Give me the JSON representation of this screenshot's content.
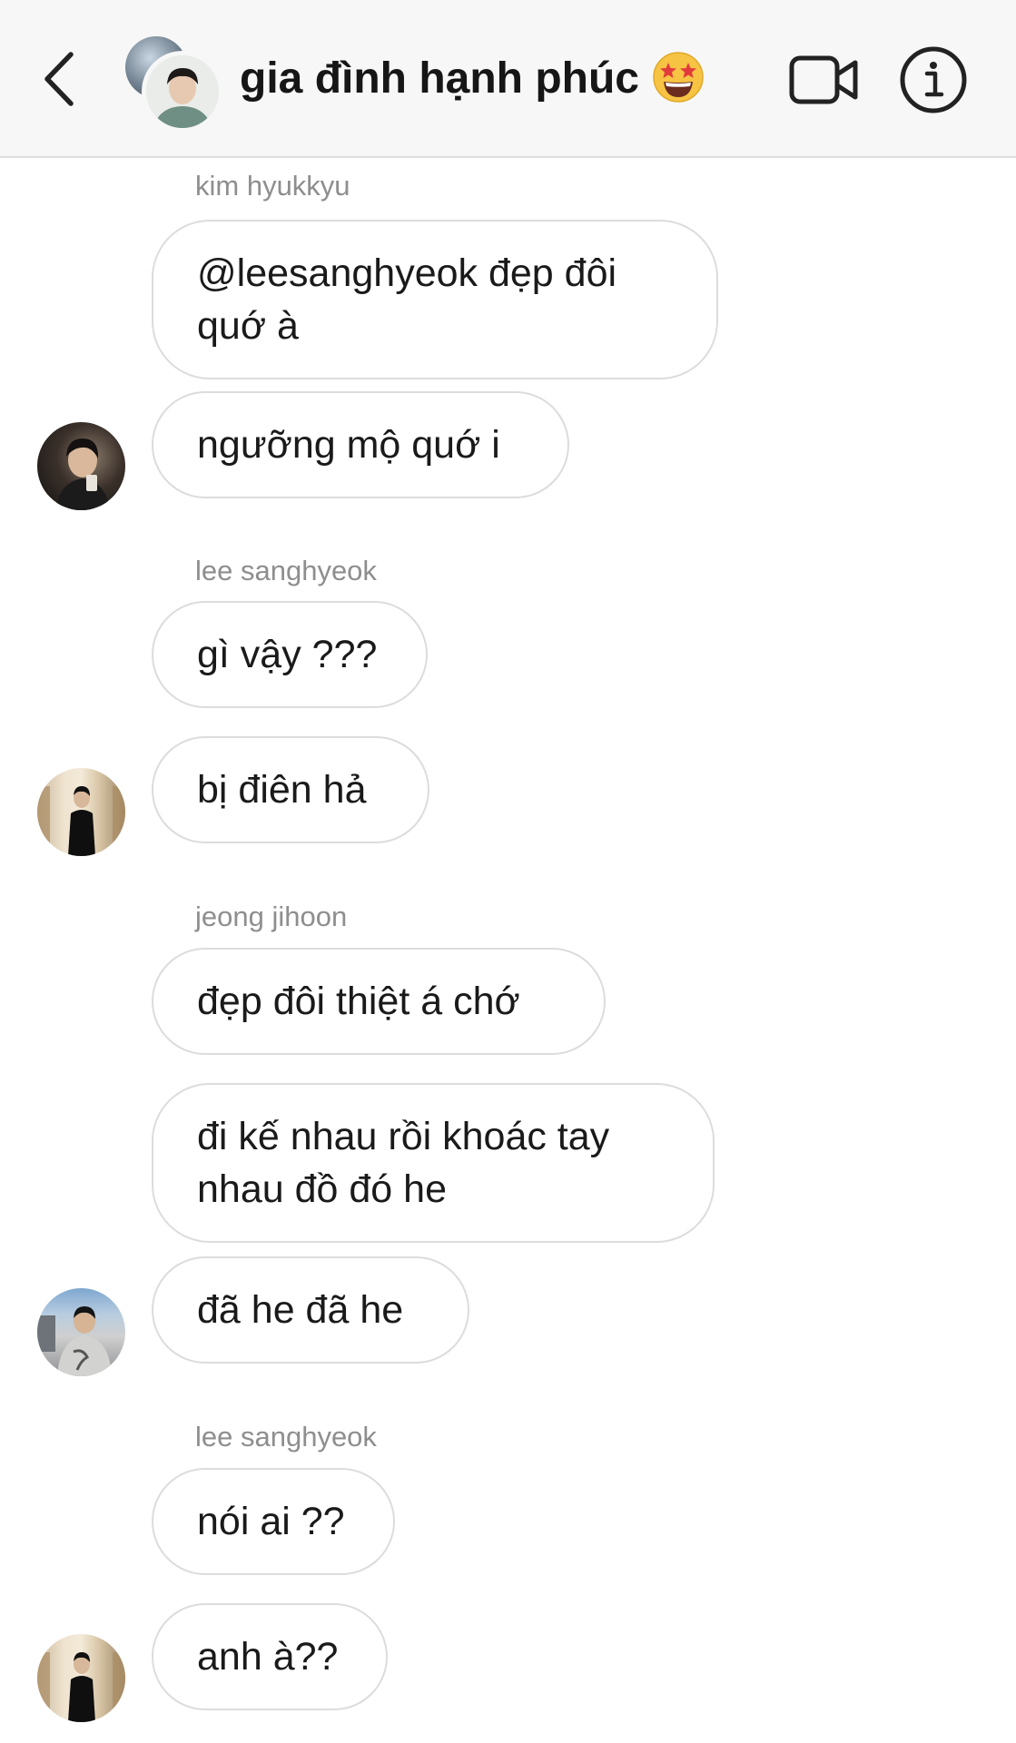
{
  "header": {
    "title": "gia đình hạnh phúc",
    "emoji_name": "star-struck-emoji",
    "back_icon": "chevron-left-icon",
    "video_icon": "video-camera-icon",
    "info_icon": "info-icon"
  },
  "colors": {
    "header_bg": "#f7f7f7",
    "bubble_border": "#dcdcdc",
    "sender_text": "#8e8e8e",
    "message_text": "#1a1a1a"
  },
  "messages": [
    {
      "sender": "kim hyukkyu",
      "lines": [
        "@leesanghyeok đẹp đôi",
        "quớ à"
      ]
    },
    {
      "lines": [
        "ngưỡng mộ quớ i"
      ]
    },
    {
      "sender": "lee sanghyeok",
      "lines": [
        "gì vậy ???"
      ]
    },
    {
      "lines": [
        "bị điên hả"
      ]
    },
    {
      "sender": "jeong jihoon",
      "lines": [
        "đẹp đôi thiệt á chớ"
      ]
    },
    {
      "lines": [
        "đi kế nhau rồi khoác tay",
        "nhau đồ đó he"
      ]
    },
    {
      "lines": [
        "đã he đã he"
      ]
    },
    {
      "sender": "lee sanghyeok",
      "lines": [
        "nói ai ??"
      ]
    },
    {
      "lines": [
        "anh à??"
      ]
    }
  ]
}
